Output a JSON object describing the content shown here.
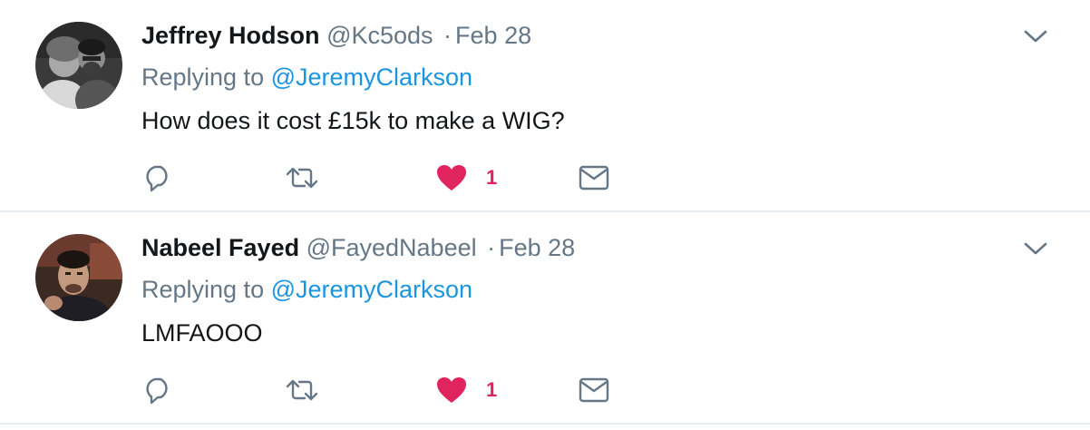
{
  "tweets": [
    {
      "fullname": "Jeffrey Hodson",
      "username": "@Kc5ods",
      "separator": "·",
      "timestamp": "Feb 28",
      "replying_prefix": "Replying to",
      "replying_to": "@JeremyClarkson",
      "text": "How does it cost £15k to make a WIG?",
      "like_count": "1",
      "liked": true
    },
    {
      "fullname": "Nabeel Fayed",
      "username": "@FayedNabeel",
      "separator": "·",
      "timestamp": "Feb 28",
      "replying_prefix": "Replying to",
      "replying_to": "@JeremyClarkson",
      "text": "LMFAOOO",
      "like_count": "1",
      "liked": true
    }
  ],
  "icons": {
    "reply": "reply-icon",
    "retweet": "retweet-icon",
    "like": "heart-icon",
    "dm": "envelope-icon",
    "more": "chevron-down-icon"
  },
  "colors": {
    "like_active": "#e0245e",
    "link": "#1b95e0",
    "secondary_text": "#657786",
    "icon": "#657786",
    "divider": "#e6ecf0"
  }
}
